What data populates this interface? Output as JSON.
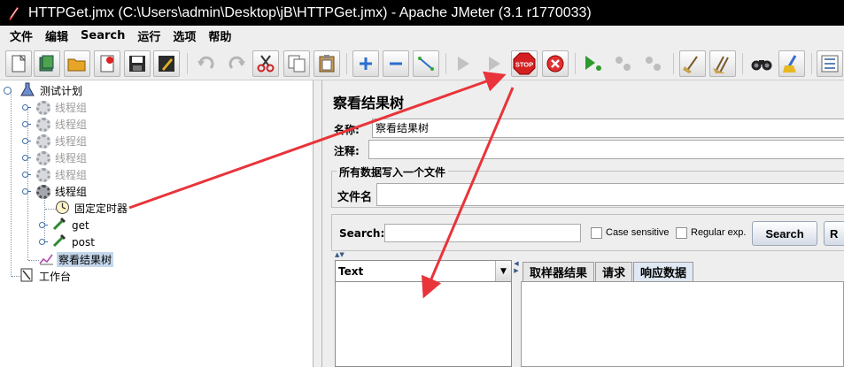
{
  "window": {
    "title": "HTTPGet.jmx (C:\\Users\\admin\\Desktop\\jB\\HTTPGet.jmx) - Apache JMeter (3.1 r1770033)"
  },
  "menu": [
    "文件",
    "编辑",
    "Search",
    "运行",
    "选项",
    "帮助"
  ],
  "toolbar": {
    "icons": [
      "new-icon",
      "templates-icon",
      "open-icon",
      "close-icon",
      "save-icon",
      "save-as-icon",
      "undo-icon",
      "redo-icon",
      "cut-icon",
      "copy-icon",
      "paste-icon",
      "expand-icon",
      "collapse-icon",
      "toggle-icon",
      "start-icon",
      "start-no-pause-icon",
      "stop-icon",
      "shutdown-icon",
      "remote-start-icon",
      "remote-stop-icon",
      "remote-shutdown-icon",
      "clear-icon",
      "clear-all-icon",
      "search-icon",
      "reset-search-icon",
      "function-helper-icon"
    ],
    "stop_label": "STOP"
  },
  "tree": {
    "root": "测试计划",
    "thread_groups": [
      "线程组",
      "线程组",
      "线程组",
      "线程组",
      "线程组"
    ],
    "active_group": "线程组",
    "children": [
      "固定定时器",
      "get",
      "post"
    ],
    "listener": "察看结果树",
    "workbench": "工作台"
  },
  "panel": {
    "title": "察看结果树",
    "name_label": "名称:",
    "name_value": "察看结果树",
    "comment_label": "注释:",
    "comment_value": "",
    "file_group_title": "所有数据写入一个文件",
    "filename_label": "文件名",
    "filename_value": ""
  },
  "search": {
    "label": "Search:",
    "value": "",
    "case_sensitive": "Case sensitive",
    "regex": "Regular exp.",
    "search_button": "Search",
    "reset_button_partial": "R"
  },
  "results": {
    "renderer": "Text",
    "tabs": [
      "取样器结果",
      "请求",
      "响应数据"
    ],
    "active_tab": "响应数据"
  },
  "colors": {
    "annotation_arrow": "#e8343a",
    "selection": "#c4d7ec",
    "stop_button": "#d42020"
  }
}
